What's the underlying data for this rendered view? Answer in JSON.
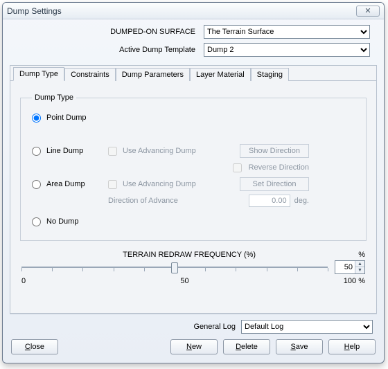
{
  "window": {
    "title": "Dump Settings",
    "close_glyph": "✕"
  },
  "header": {
    "surface_label": "DUMPED-ON SURFACE",
    "surface_value": "The Terrain Surface",
    "template_label": "Active Dump Template",
    "template_value": "Dump 2"
  },
  "tabs": [
    "Dump Type",
    "Constraints",
    "Dump Parameters",
    "Layer Material",
    "Staging"
  ],
  "active_tab": 0,
  "dump_type": {
    "legend": "Dump Type",
    "options": {
      "point": "Point Dump",
      "line": "Line Dump",
      "area": "Area Dump",
      "none": "No Dump"
    },
    "selected": "point",
    "use_advancing_label": "Use Advancing Dump",
    "show_direction_btn": "Show Direction",
    "reverse_direction_label": "Reverse Direction",
    "set_direction_btn": "Set Direction",
    "direction_of_advance_label": "Direction of Advance",
    "direction_value": "0.00",
    "direction_unit": "deg."
  },
  "redraw": {
    "label": "TERRAIN  REDRAW  FREQUENCY (%)",
    "pct_symbol": "%",
    "value": "50",
    "scale_min": "0",
    "scale_mid": "50",
    "scale_max": "100 %"
  },
  "log": {
    "label": "General Log",
    "value": "Default Log"
  },
  "buttons": {
    "close": "Close",
    "new": "New",
    "delete": "Delete",
    "save": "Save",
    "help": "Help"
  }
}
